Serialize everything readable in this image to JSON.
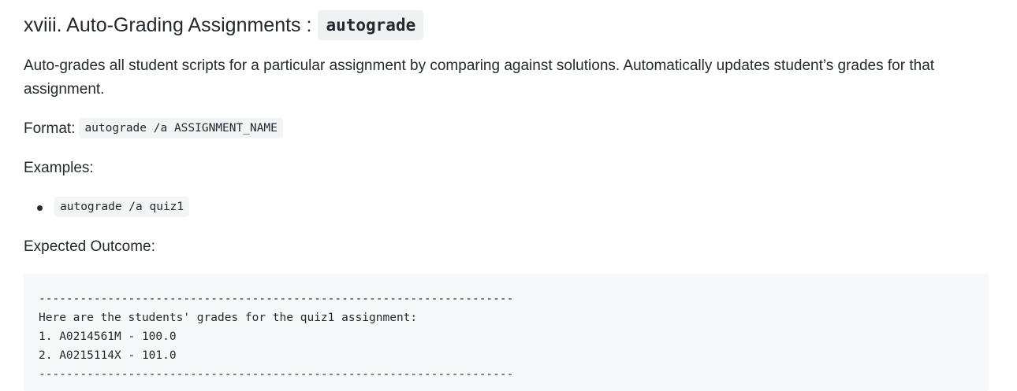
{
  "section": {
    "heading_text": "xviii. Auto-Grading Assignments :",
    "heading_code": "autograde",
    "description": "Auto-grades all student scripts for a particular assignment by comparing against solutions. Automatically updates student’s grades for that assignment.",
    "format_label": "Format:",
    "format_code": "autograde /a ASSIGNMENT_NAME",
    "examples_label": "Examples:",
    "examples": [
      "autograde /a quiz1"
    ],
    "outcome_label": "Expected Outcome:",
    "outcome_lines": [
      "---------------------------------------------------------------------",
      "Here are the students' grades for the quiz1 assignment:",
      "1. A0214561M - 100.0",
      "2. A0215114X - 101.0",
      "---------------------------------------------------------------------"
    ]
  }
}
